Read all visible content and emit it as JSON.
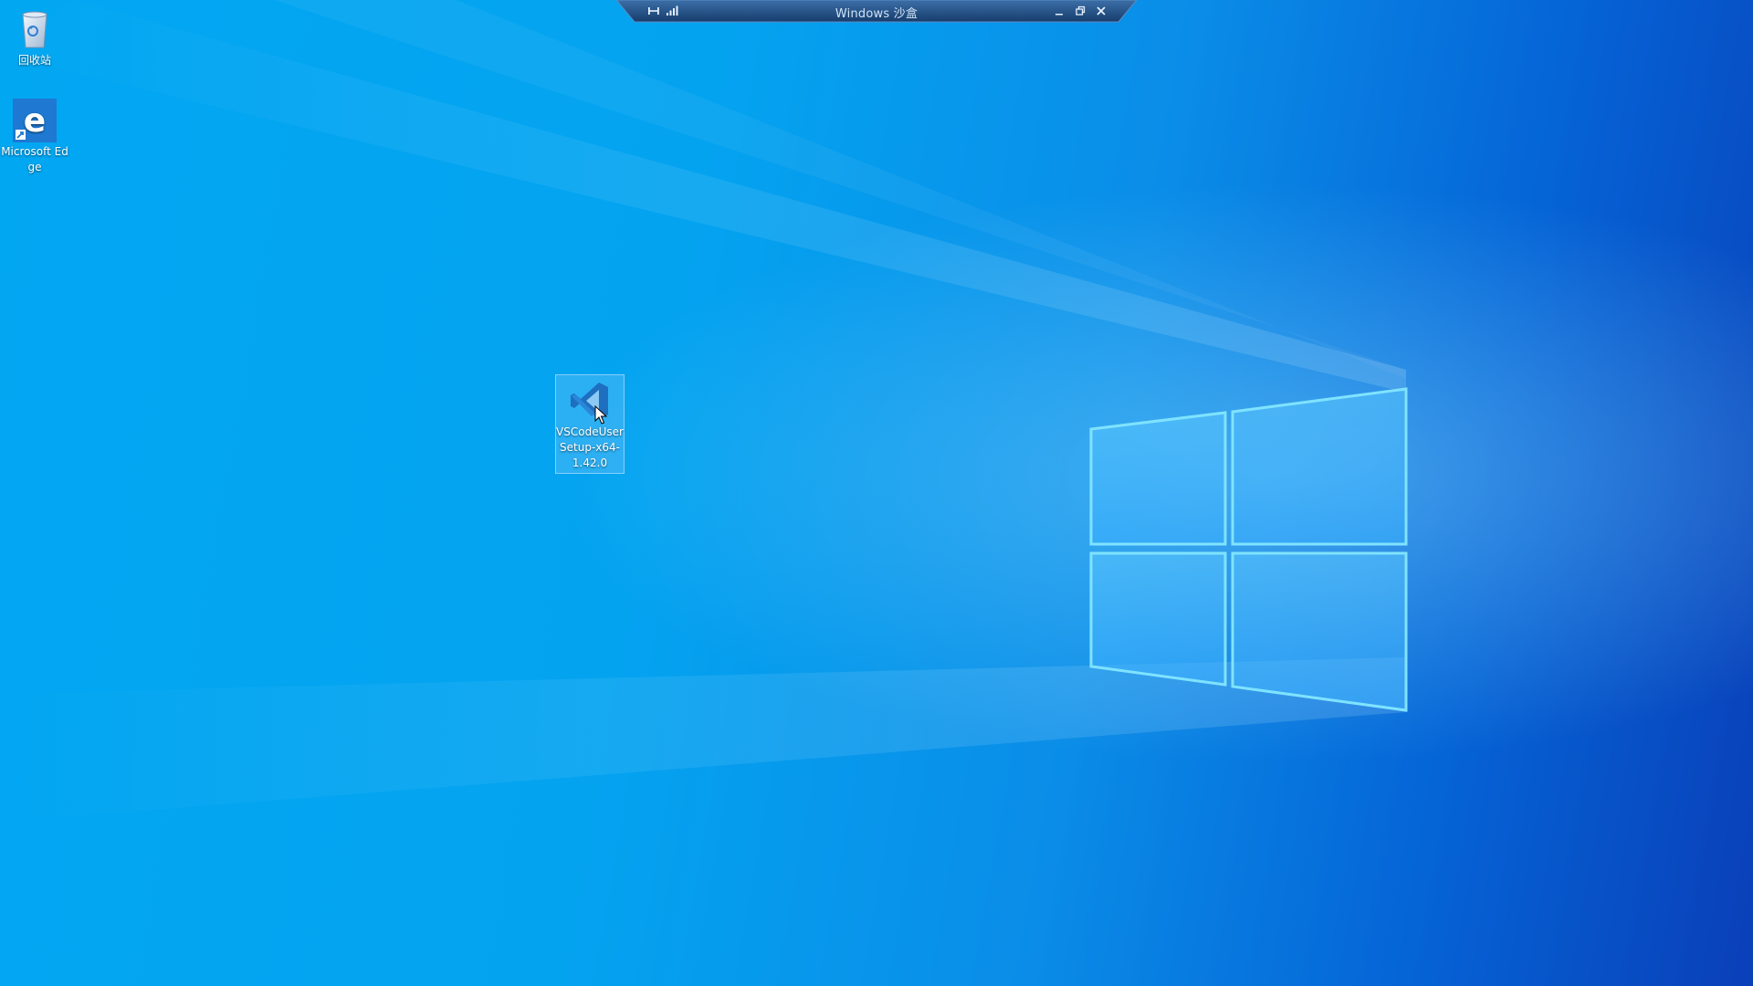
{
  "sandbox_bar": {
    "title": "Windows 沙盒",
    "buttons": {
      "pin": "pin-icon",
      "signal": "connection-signal-icon",
      "minimize": "minimize-icon",
      "restore": "restore-icon",
      "close": "close-icon"
    }
  },
  "desktop": {
    "icons": [
      {
        "label": "回收站",
        "icon": "recycle-bin-icon"
      },
      {
        "label": "Microsoft Edge",
        "icon": "edge-icon"
      },
      {
        "label": "VSCodeUserSetup-x64-1.42.0",
        "icon": "vscode-installer-icon",
        "selected": true
      }
    ]
  },
  "colors": {
    "desktop_left": "#02a7f2",
    "desktop_right": "#0a3fb8",
    "bar": "#1f4f86",
    "selection": "#b4dcff"
  }
}
